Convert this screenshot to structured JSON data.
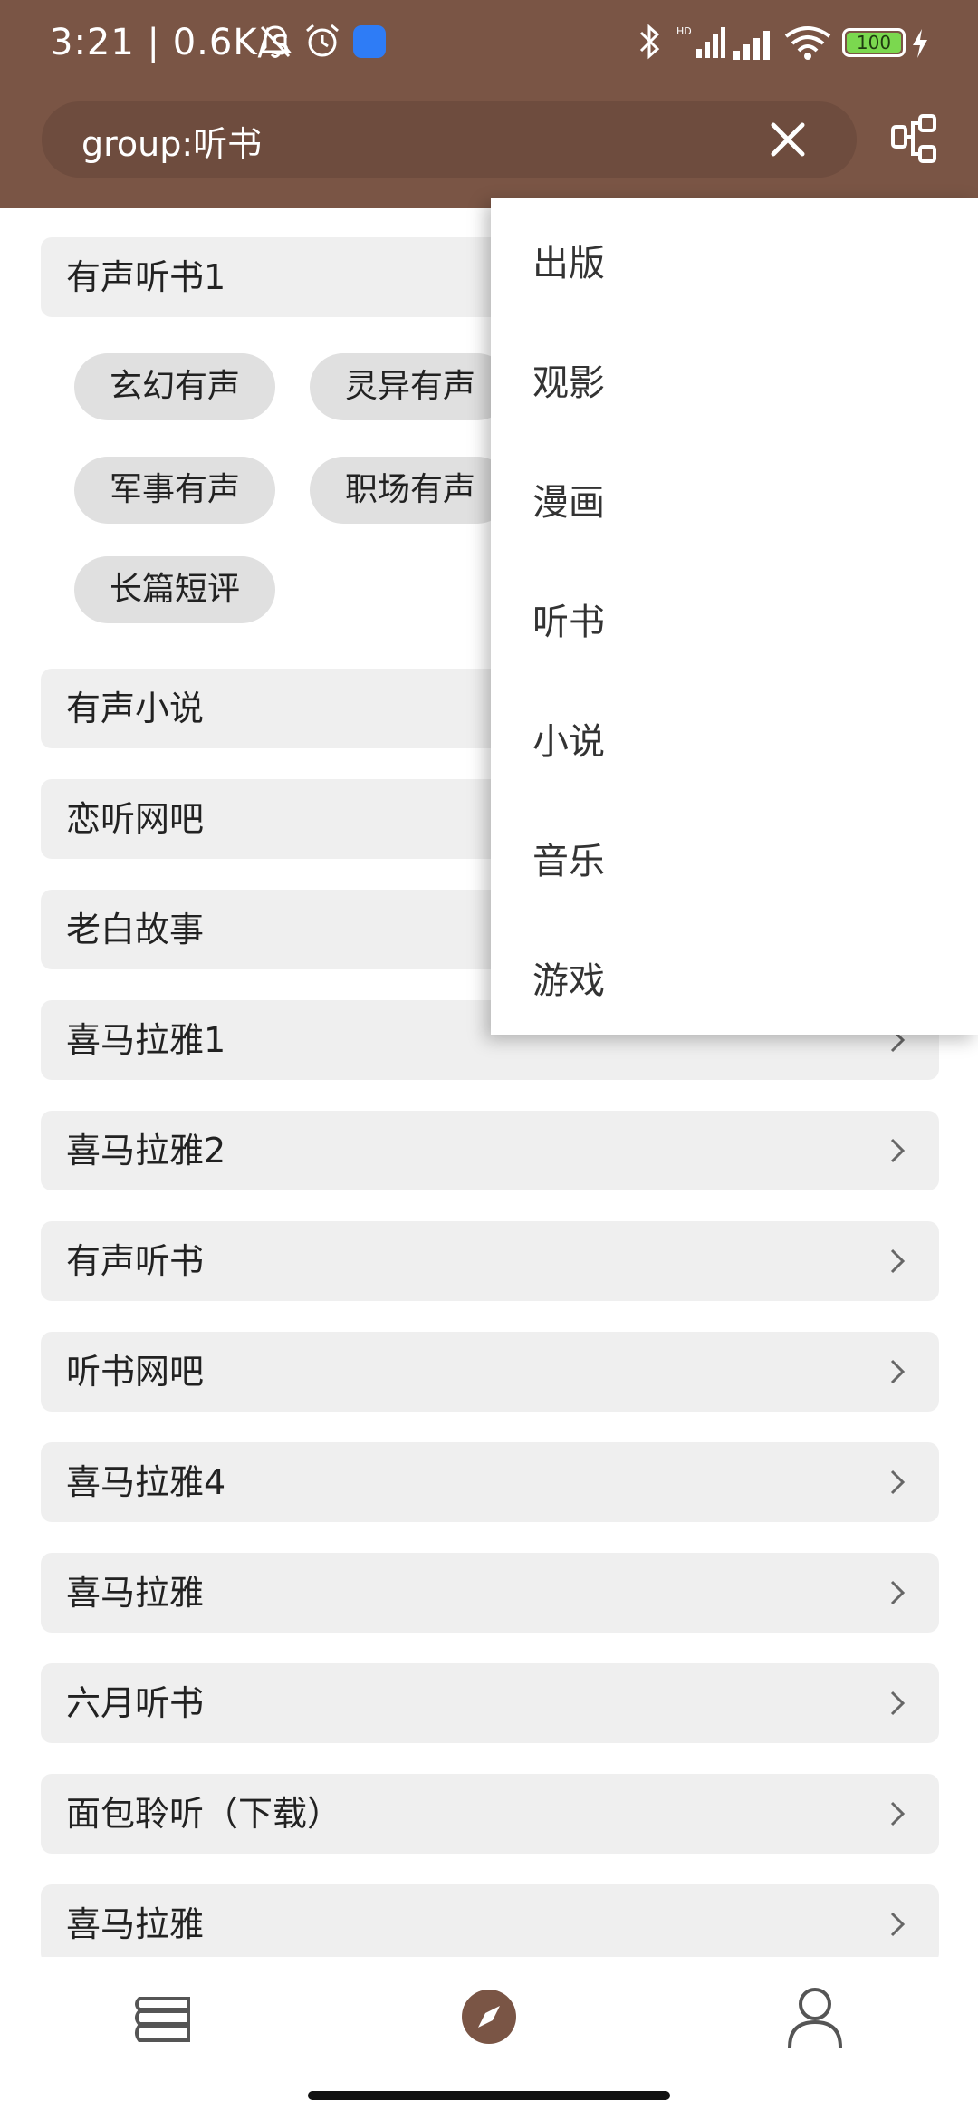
{
  "status_bar": {
    "time": "3:21 | 0.6K/s",
    "battery_level": "100",
    "icons": [
      "bell-muted-icon",
      "alarm-icon",
      "app-badge-icon",
      "bluetooth-icon",
      "hd-signal-icon",
      "signal-icon",
      "wifi-icon",
      "battery-icon",
      "charging-icon"
    ]
  },
  "search": {
    "value": "group:听书",
    "clear_icon": "close-icon",
    "filter_icon": "group-filter-icon"
  },
  "list": {
    "group_title": "有声听书1",
    "chips": [
      "玄幻有声",
      "灵异有声",
      "军事有声",
      "职场有声",
      "长篇短评"
    ],
    "items": [
      "有声小说",
      "恋听网吧",
      "老白故事",
      "喜马拉雅1",
      "喜马拉雅2",
      "有声听书",
      "听书网吧",
      "喜马拉雅4",
      "喜马拉雅",
      "六月听书",
      "面包聆听（下载）",
      "喜马拉雅"
    ]
  },
  "menu": {
    "items": [
      "出版",
      "观影",
      "漫画",
      "听书",
      "小说",
      "音乐",
      "游戏"
    ]
  },
  "bottom_nav": {
    "items": [
      "bookshelf-icon",
      "discover-compass-icon",
      "profile-icon"
    ],
    "accent": "#7a5545"
  },
  "colors": {
    "header": "#7a5545",
    "row_bg": "#efefef",
    "chip_bg": "#e0e0e0"
  }
}
